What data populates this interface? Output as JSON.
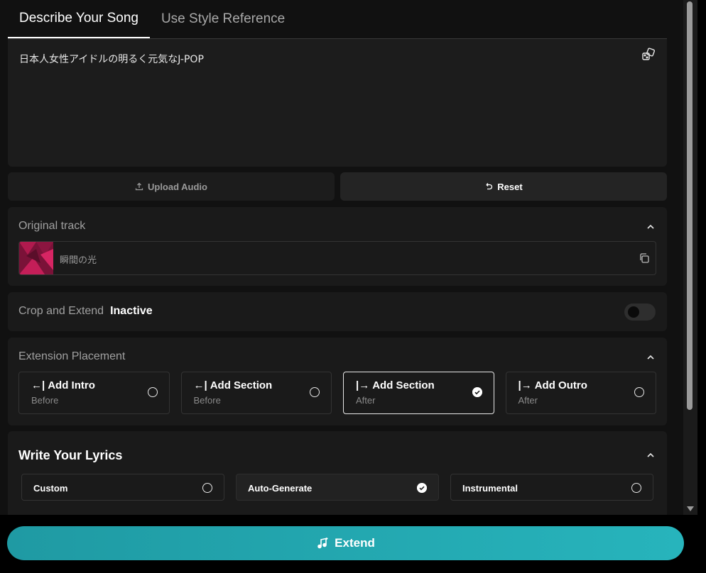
{
  "tabs": [
    {
      "label": "Describe Your Song",
      "active": true
    },
    {
      "label": "Use Style Reference",
      "active": false
    }
  ],
  "description": {
    "text": "日本人女性アイドルの明るく元気なJ-POP",
    "icon": "dice-icon"
  },
  "actions": {
    "upload_label": "Upload Audio",
    "reset_label": "Reset"
  },
  "original_track": {
    "title": "Original track",
    "track_name": "瞬間の光"
  },
  "crop": {
    "title": "Crop and Extend",
    "status": "Inactive",
    "enabled": false
  },
  "placement": {
    "title": "Extension Placement",
    "options": [
      {
        "arrow": "←|",
        "label": "Add Intro",
        "sub": "Before",
        "selected": false
      },
      {
        "arrow": "←|",
        "label": "Add Section",
        "sub": "Before",
        "selected": false
      },
      {
        "arrow": "|→",
        "label": "Add Section",
        "sub": "After",
        "selected": true
      },
      {
        "arrow": "|→",
        "label": "Add Outro",
        "sub": "After",
        "selected": false
      }
    ]
  },
  "lyrics": {
    "title": "Write Your Lyrics",
    "options": [
      {
        "label": "Custom",
        "selected": false
      },
      {
        "label": "Auto-Generate",
        "selected": true
      },
      {
        "label": "Instrumental",
        "selected": false
      }
    ]
  },
  "footer": {
    "extend_label": "Extend"
  },
  "colors": {
    "accent": "#22a9b2",
    "background": "#111111",
    "panel": "#1a1a1a"
  }
}
